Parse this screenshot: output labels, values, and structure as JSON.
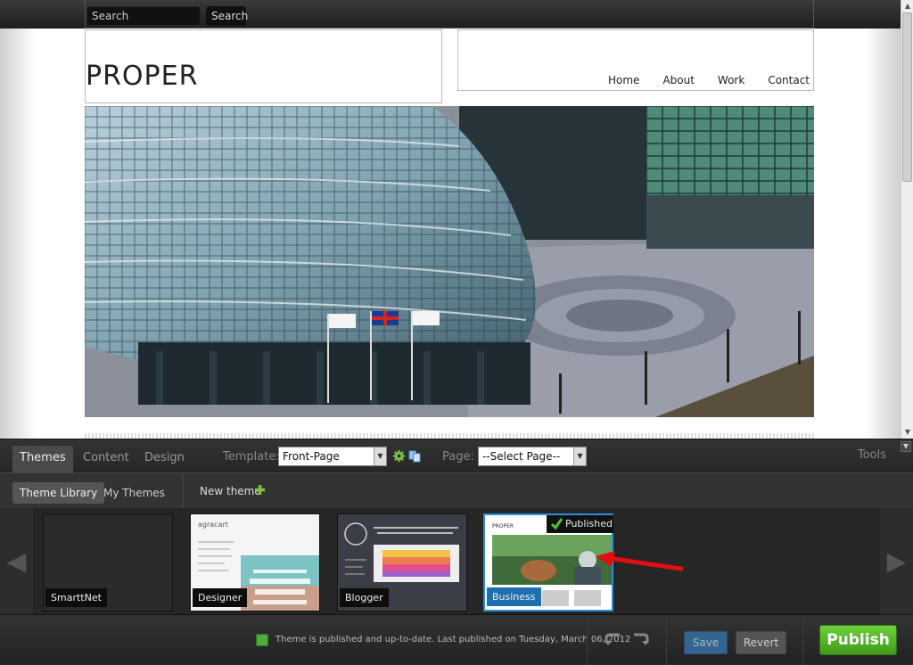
{
  "site": {
    "search_placeholder": "Search",
    "search_button": "Search",
    "logo": "PROPER",
    "nav": [
      "Home",
      "About",
      "Work",
      "Contact"
    ]
  },
  "editor": {
    "tabs": [
      {
        "label": "Themes",
        "active": true
      },
      {
        "label": "Content",
        "active": false
      },
      {
        "label": "Design",
        "active": false
      }
    ],
    "template_label": "Template:",
    "template_value": "Front-Page",
    "page_label": "Page:",
    "page_value": "--Select Page--",
    "tools_label": "Tools",
    "subtabs": [
      {
        "label": "Theme Library",
        "active": true
      },
      {
        "label": "My Themes",
        "active": false
      }
    ],
    "new_theme_label": "New theme",
    "themes": [
      {
        "name": "SmarttNet"
      },
      {
        "name": "Designer"
      },
      {
        "name": "Blogger"
      },
      {
        "name": "Business",
        "badge": "Published"
      }
    ],
    "status_text": "Theme is published and up-to-date. Last published on Tuesday, March 06, 2012",
    "save_label": "Save",
    "revert_label": "Revert",
    "publish_label": "Publish",
    "colors": {
      "publish": "#4cae22",
      "save": "#35658e",
      "status": "#4caf3a",
      "selected_border": "#2a8ed8",
      "annotation_arrow": "#e01010"
    }
  }
}
